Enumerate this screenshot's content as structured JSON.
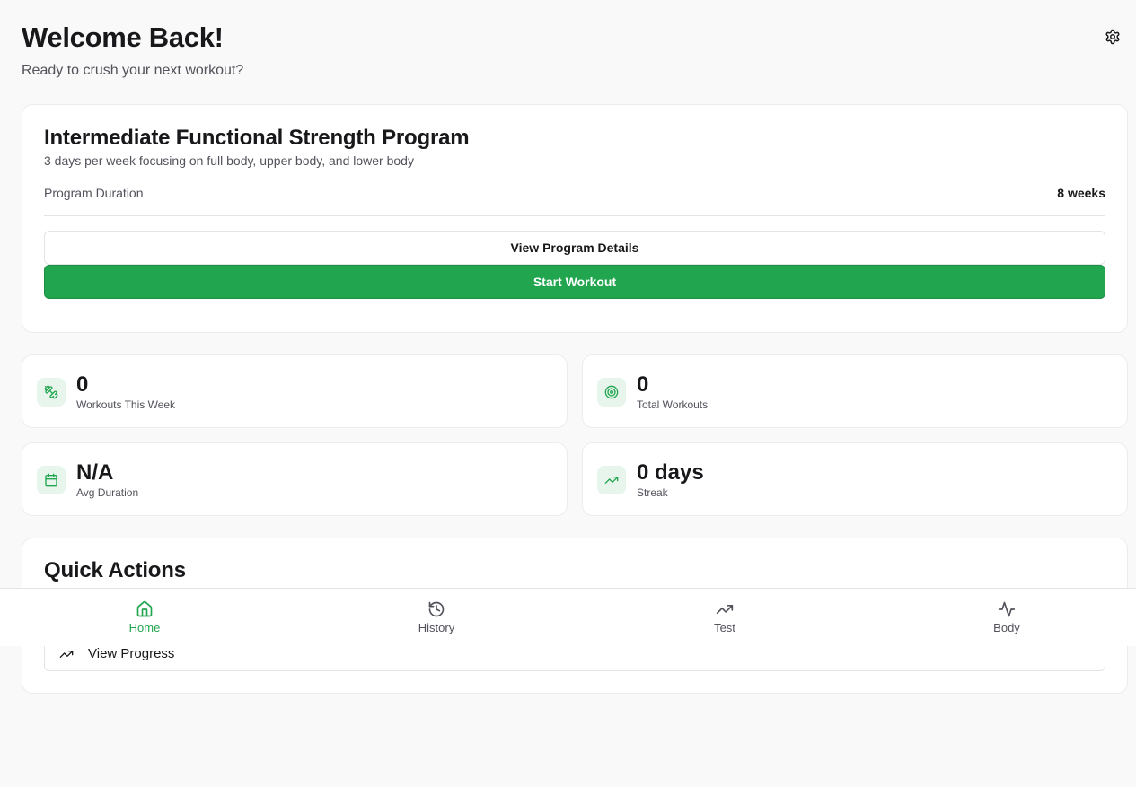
{
  "header": {
    "title": "Welcome Back!",
    "subtitle": "Ready to crush your next workout?",
    "settings_icon": "gear-icon"
  },
  "program": {
    "title": "Intermediate Functional Strength Program",
    "description": "3 days per week focusing on full body, upper body, and lower body",
    "duration_label": "Program Duration",
    "duration_value": "8 weeks",
    "details_button": "View Program Details",
    "start_button": "Start Workout"
  },
  "stats": [
    {
      "value": "0",
      "label": "Workouts This Week",
      "icon": "dumbbell-icon"
    },
    {
      "value": "0",
      "label": "Total Workouts",
      "icon": "target-icon"
    },
    {
      "value": "N/A",
      "label": "Avg Duration",
      "icon": "calendar-icon"
    },
    {
      "value": "0 days",
      "label": "Streak",
      "icon": "trending-up-icon"
    }
  ],
  "quick_actions": {
    "title": "Quick Actions",
    "items": [
      {
        "label": "View Progress",
        "icon": "trending-up-icon"
      }
    ]
  },
  "nav": {
    "items": [
      {
        "label": "Home",
        "icon": "home-icon",
        "active": true
      },
      {
        "label": "History",
        "icon": "history-icon",
        "active": false
      },
      {
        "label": "Test",
        "icon": "trending-up-icon",
        "active": false
      },
      {
        "label": "Body",
        "icon": "activity-icon",
        "active": false
      }
    ]
  },
  "colors": {
    "accent": "#21a64f",
    "accent_soft": "#e8f5ec",
    "background": "#f9f9f9",
    "text_muted": "#52525b"
  }
}
